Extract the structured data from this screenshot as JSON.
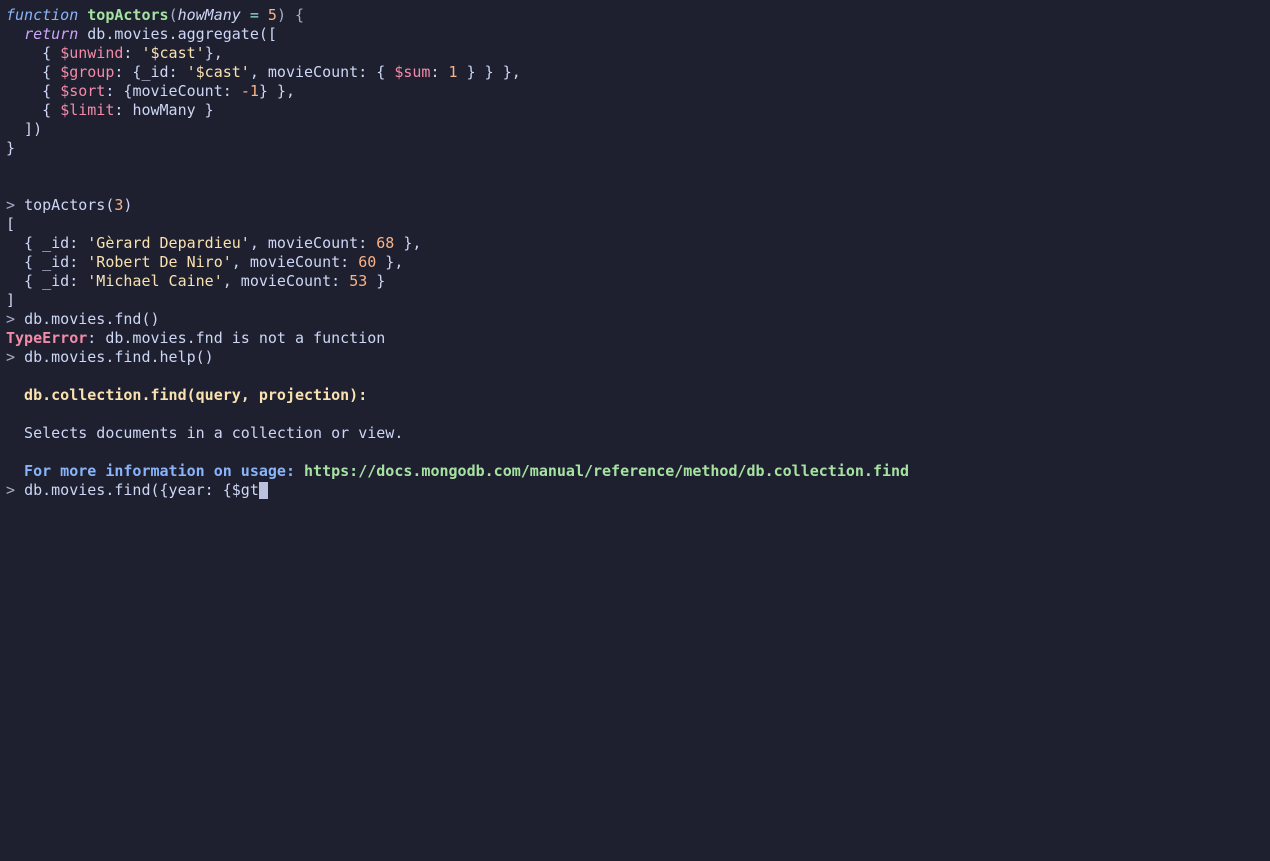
{
  "code": {
    "function_keyword": "function",
    "function_name": "topActors",
    "param_name": "howMany",
    "eq": " = ",
    "default_val": "5",
    "open_paren": "(",
    "close_paren_brace": ") {",
    "return_kw": "return",
    "db_call": " db.movies.aggregate([",
    "unwind_open": "    { ",
    "unwind_op": "$unwind",
    "colon": ": ",
    "cast_str": "'$cast'",
    "close_obj_comma": "},",
    "group_op": "$group",
    "group_body_open": ": {",
    "id_key": "_id",
    "movie_count_key": "movieCount",
    "sum_op": "$sum",
    "sum_val": "1",
    "group_close": " } } },",
    "sort_op": "$sort",
    "sort_open": ": {",
    "sort_val": "-1",
    "sort_close": "} },",
    "limit_op": "$limit",
    "limit_param": "howMany",
    "limit_close": " }",
    "arr_close": "  ])",
    "fn_close": "}"
  },
  "call": {
    "prompt": "> ",
    "fn": "topActors(",
    "arg": "3",
    "close": ")"
  },
  "results": {
    "open": "[",
    "r1_open": "  { _id: ",
    "r1_name": "'Gèrard Depardieu'",
    "r1_mid": ", movieCount: ",
    "r1_val": "68",
    "r1_close": " },",
    "r2_name": "'Robert De Niro'",
    "r2_val": "60",
    "r2_close": " },",
    "r3_name": "'Michael Caine'",
    "r3_val": "53",
    "r3_close": " }",
    "close": "]"
  },
  "error": {
    "prompt": "> ",
    "cmd": "db.movies.fnd()",
    "type": "TypeError",
    "msg": ": db.movies.fnd is not a function"
  },
  "help": {
    "prompt": "> ",
    "cmd": "db.movies.find.help()",
    "blank": "",
    "sig": "  db.collection.find(query, projection):",
    "desc": "  Selects documents in a collection or view.",
    "info_label": "  For more information on usage: ",
    "url": "https://docs.mongodb.com/manual/reference/method/db.collection.find"
  },
  "input": {
    "prompt": "> ",
    "text": "db.movies.find({year: {$gt"
  }
}
